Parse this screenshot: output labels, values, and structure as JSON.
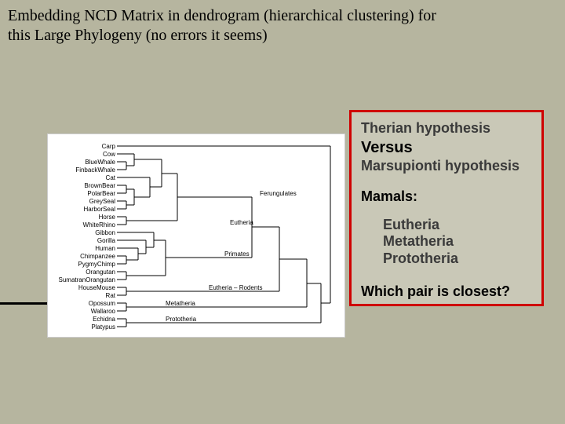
{
  "title_line1": "Embedding NCD Matrix in dendrogram (hierarchical clustering) for",
  "title_line2": "this Large Phylogeny (no errors it seems)",
  "box": {
    "hyp1": "Therian hypothesis",
    "versus": "Versus",
    "hyp2": "Marsupionti hypothesis",
    "mamals": "Mamals:",
    "sub1": "Eutheria",
    "sub2": "Metatheria",
    "sub3": "Prototheria",
    "closest": "Which pair is closest?"
  },
  "dendro": {
    "species": [
      "Carp",
      "Cow",
      "BlueWhale",
      "FinbackWhale",
      "Cat",
      "BrownBear",
      "PolarBear",
      "GreySeal",
      "HarborSeal",
      "Horse",
      "WhiteRhino",
      "Gibbon",
      "Gorilla",
      "Human",
      "Chimpanzee",
      "PygmyChimp",
      "Orangutan",
      "SumatranOrangutan",
      "HouseMouse",
      "Rat",
      "Opossum",
      "Wallaroo",
      "Echidna",
      "Platypus"
    ],
    "group_labels": {
      "ferungulates": "Ferungulates",
      "eutheria": "Eutheria",
      "primates": "Primates",
      "eutheria_rodents": "Eutheria – Rodents",
      "metatheria": "Metatheria",
      "prototheria": "Prototheria"
    }
  }
}
